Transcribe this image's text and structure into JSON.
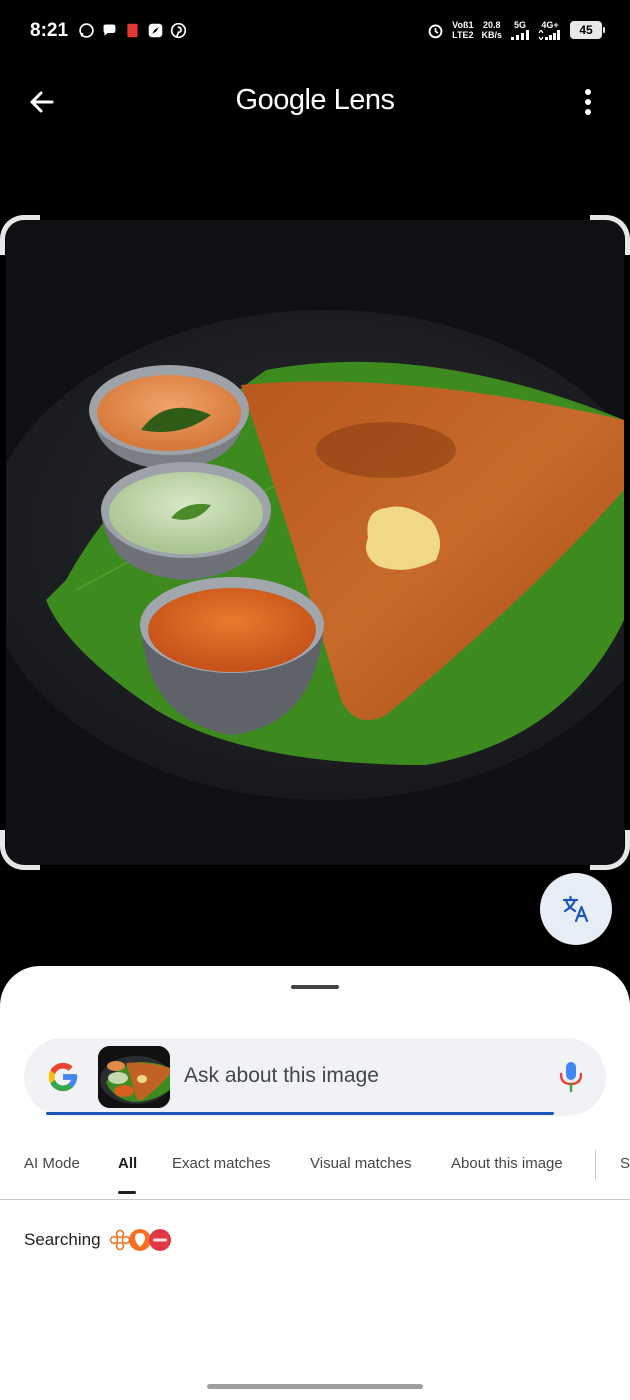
{
  "status_bar": {
    "time": "8:21",
    "network_label_1": "Voß1",
    "network_label_2": "LTE2",
    "speed_value": "20.8",
    "speed_unit": "KB/s",
    "sim1_label": "5G",
    "sim2_label": "4G+",
    "battery": "45"
  },
  "app_bar": {
    "title": "Google Lens"
  },
  "image": {
    "subject_icons": [
      "plate",
      "dosa",
      "chutney-bowls"
    ]
  },
  "search": {
    "placeholder": "Ask about this image"
  },
  "tabs": {
    "items": [
      {
        "label": "AI Mode"
      },
      {
        "label": "All"
      },
      {
        "label": "Exact matches"
      },
      {
        "label": "Visual matches"
      },
      {
        "label": "About this image"
      },
      {
        "label": "S"
      }
    ],
    "active": "All"
  },
  "results": {
    "status_text": "Searching"
  },
  "colors": {
    "accent_blue": "#1a56b8",
    "google_blue": "#4285F4",
    "google_red": "#EA4335",
    "google_yellow": "#FBBC05",
    "google_green": "#34A853"
  }
}
